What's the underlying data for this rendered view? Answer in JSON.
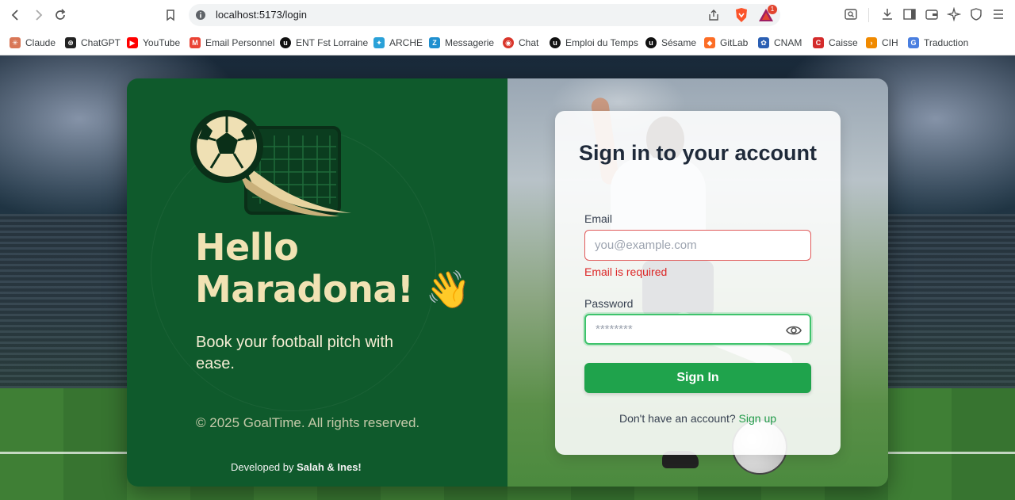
{
  "browser": {
    "url": "localhost:5173/login",
    "bat_badge": "1"
  },
  "bookmarks": [
    {
      "label": "Claude",
      "icon": "claude-icon",
      "color": "#d97757"
    },
    {
      "label": "ChatGPT",
      "icon": "chatgpt-icon",
      "color": "#222222"
    },
    {
      "label": "YouTube",
      "icon": "youtube-icon",
      "color": "#ff0000"
    },
    {
      "label": "Email Personnel",
      "icon": "gmail-icon",
      "color": "#ea4335"
    },
    {
      "label": "ENT Fst Lorraine",
      "icon": "lorraine-icon",
      "color": "#111111"
    },
    {
      "label": "ARCHE",
      "icon": "arche-icon",
      "color": "#2aa1d8"
    },
    {
      "label": "Messagerie",
      "icon": "zimbra-icon",
      "color": "#1f8fcf"
    },
    {
      "label": "Chat",
      "icon": "chat-icon",
      "color": "#d9362b"
    },
    {
      "label": "Emploi du Temps",
      "icon": "lorraine-icon",
      "color": "#111111"
    },
    {
      "label": "Sésame",
      "icon": "lorraine-icon",
      "color": "#111111"
    },
    {
      "label": "GitLab",
      "icon": "gitlab-icon",
      "color": "#fc6d26"
    },
    {
      "label": "CNAM",
      "icon": "cnam-icon",
      "color": "#2b5fb3"
    },
    {
      "label": "Caisse",
      "icon": "caisse-icon",
      "color": "#d42b2b"
    },
    {
      "label": "CIH",
      "icon": "cih-icon",
      "color": "#f08a00"
    },
    {
      "label": "Traduction",
      "icon": "translate-icon",
      "color": "#4a7fe0"
    }
  ],
  "left_panel": {
    "hello_line1": "Hello",
    "hello_line2": "Maradona! 👋",
    "tagline": "Book your football pitch with ease.",
    "copyright": "© 2025 GoalTime. All rights reserved.",
    "dev_prefix": "Developed by",
    "dev_names": "Salah & Ines!"
  },
  "form": {
    "title": "Sign in to your account",
    "email_label": "Email",
    "email_placeholder": "you@example.com",
    "email_value": "",
    "email_error": "Email is required",
    "password_label": "Password",
    "password_placeholder": "********",
    "password_value": "",
    "submit_label": "Sign In",
    "signup_prompt": "Don't have an account?",
    "signup_link": "Sign up"
  },
  "colors": {
    "panel_green": "#0f5a2c",
    "accent_green": "#1fa34c",
    "cream": "#f1e2b3",
    "error_red": "#dc2626"
  }
}
